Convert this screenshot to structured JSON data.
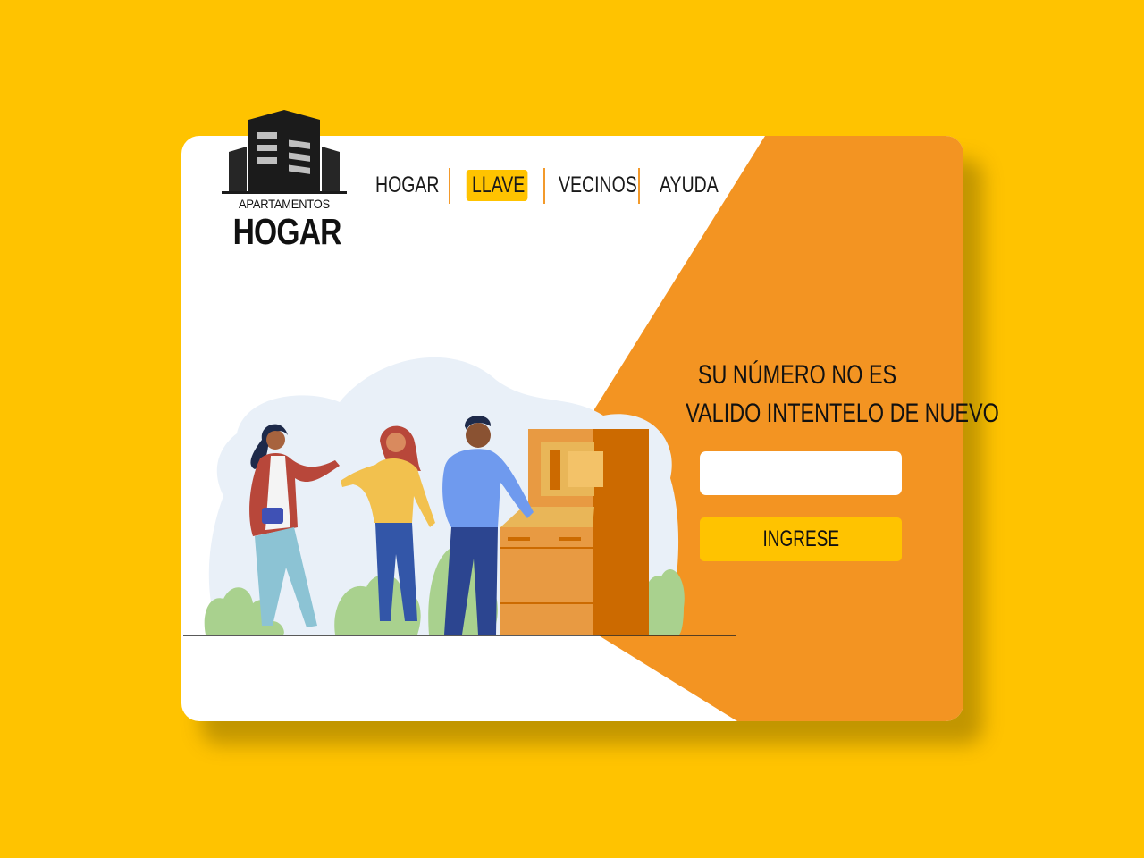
{
  "logo": {
    "line1": "APARTAMENTOS",
    "line2": "HOGAR",
    "icon": "building-icon"
  },
  "nav": {
    "items": [
      {
        "label": "HOGAR",
        "active": false
      },
      {
        "label": "LLAVE",
        "active": true
      },
      {
        "label": "VECINOS",
        "active": false
      },
      {
        "label": "AYUDA",
        "active": false
      }
    ]
  },
  "form": {
    "message_line1": "SU NÚMERO NO ES",
    "message_line2": "VALIDO INTENTELO DE NUEVO",
    "input_value": "",
    "submit_label": "INGRESE"
  },
  "colors": {
    "background": "#FFC300",
    "accent_orange": "#F39422",
    "highlight_yellow": "#FFC300",
    "card": "#FFFFFF"
  }
}
